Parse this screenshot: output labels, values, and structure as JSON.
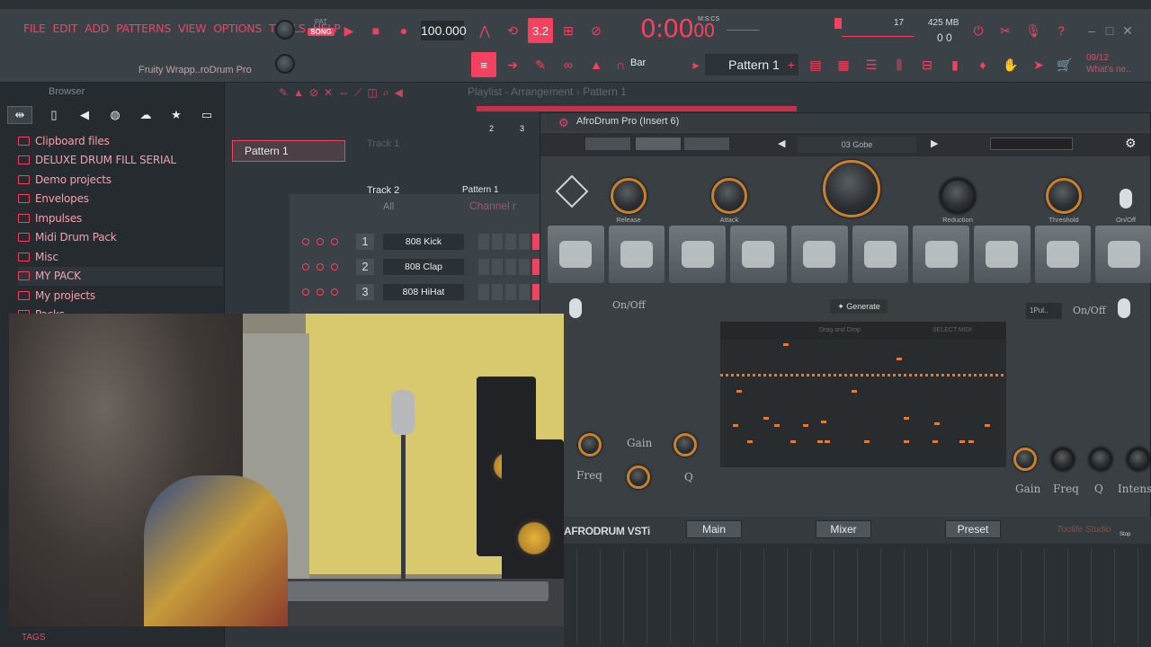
{
  "menu": [
    "FILE",
    "EDIT",
    "ADD",
    "PATTERNS",
    "VIEW",
    "OPTIONS",
    "TOOLS",
    "HELP"
  ],
  "hint": "Fruity Wrapp..roDrum Pro",
  "transport": {
    "pat_label": "PAT",
    "song_label": "SONG",
    "tempo": "100.000",
    "time": "0:00",
    "time_sub": "00",
    "time_label": "M:S:CS"
  },
  "cpu": {
    "value": "17",
    "memory": "425 MB",
    "polyphony": "0",
    "memory_sub": "0"
  },
  "toolbar": {
    "snap": "Bar",
    "pattern": "Pattern 1",
    "news": "09/12",
    "news_title": "What's ne..",
    "rec_value": "3.2"
  },
  "browser": {
    "title": "Browser",
    "items": [
      "Clipboard files",
      "DELUXE DRUM FILL SERIAL",
      "Demo projects",
      "Envelopes",
      "Impulses",
      "Midi Drum Pack",
      "Misc",
      "MY PACK",
      "My projects",
      "Packs"
    ],
    "tags": "TAGS"
  },
  "playlist": {
    "title": "Playlist - Arrangement",
    "crumb": "Pattern 1",
    "clip": "Pattern 1",
    "track1": "Track 1",
    "track2": "Track 2",
    "clip2": "Pattern 1",
    "ruler": [
      "2",
      "3"
    ]
  },
  "channel_rack": {
    "filter": "All",
    "title": "Channel r",
    "channels": [
      {
        "num": "1",
        "name": "808 Kick"
      },
      {
        "num": "2",
        "name": "808 Clap"
      },
      {
        "num": "3",
        "name": "808 HiHat"
      }
    ]
  },
  "plugin": {
    "title": "AfroDrum Pro (Insert 6)",
    "preset": "03 Gobe",
    "knobs": [
      "Release",
      "Attack",
      "Reduction",
      "Threshold",
      "On/Off"
    ],
    "onoff_left": "On/Off",
    "onoff_right": "On/Off",
    "generate": "Generate",
    "drag_drop": "Drag and Drop",
    "select_midi": "SELECT MIDI",
    "midi_select": "1Pul..",
    "left_labels": {
      "gain": "Gain",
      "freq": "Freq",
      "q": "Q"
    },
    "right_labels": {
      "gain": "Gain",
      "freq": "Freq",
      "q": "Q",
      "intensity": "Intensit"
    },
    "footer_title": "AFRODRUM VSTi",
    "buttons": [
      "Main",
      "Mixer",
      "Preset"
    ],
    "studio": "Toolife Studio",
    "stop": "Stop"
  },
  "colors": {
    "accent": "#f2425f",
    "knob_ring": "#c8802e",
    "note": "#e07a3a"
  }
}
